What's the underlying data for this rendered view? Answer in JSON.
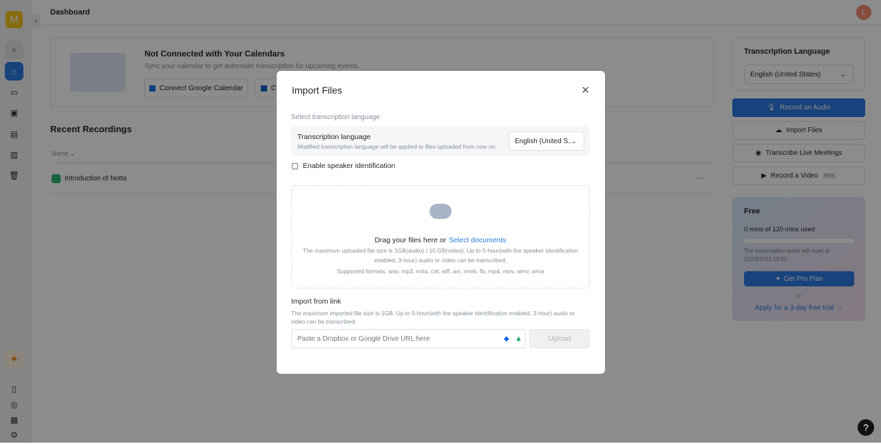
{
  "sidebar": {
    "logo_letter": "M",
    "icons": [
      "search-icon",
      "home-icon",
      "folder-icon",
      "calendar-icon",
      "calendar-edit-icon",
      "notes-icon",
      "trash-icon"
    ],
    "bottom_icons": [
      "book-icon",
      "location-icon",
      "gift-icon",
      "settings-icon"
    ]
  },
  "header": {
    "title": "Dashboard",
    "avatar_letter": "L"
  },
  "calendar": {
    "title": "Not Connected with Your Calendars",
    "subtitle": "Sync your calendar to get automatic transcription for upcoming events.",
    "google_button": "Connect Google Calendar",
    "outlook_button": "C"
  },
  "recordings": {
    "title": "Recent Recordings",
    "column_name": "Name",
    "items": [
      {
        "name": "Introduction of Notta",
        "more": "···"
      }
    ]
  },
  "right_panel": {
    "language_title": "Transcription Language",
    "language_value": "English (United States)",
    "record_audio": "Record an Audio",
    "import_files": "Import Files",
    "transcribe_live": "Transcribe Live Meetings",
    "record_video": "Record a Video",
    "beta": "Beta",
    "plan": {
      "name": "Free",
      "usage": "0 mins of 120 mins used",
      "usage_fraction": 0,
      "reset_note": "The transcription quote will reset at 12/19/2023 10:52",
      "pro_button": "Get Pro Plan",
      "or": "or",
      "trial_link": "Apply for a 3-day free trial →"
    }
  },
  "modal": {
    "title": "Import Files",
    "section_label": "Select transcription language",
    "lang_title": "Transcription language",
    "lang_desc": "Modified transcription language will be applied to files uploaded from now on.",
    "lang_value": "English (United S...",
    "speaker_label": "Enable speaker identification",
    "speaker_checked": false,
    "drop_text": "Drag your files here or",
    "select_link": "Select documents",
    "drop_limits": "The maximum uploaded file size is 1GB(audio) / 10 GB(video). Up to 5-hour(with the speaker identification enabled, 3-hour) audio or video can be transcribed.",
    "drop_formats": "Supported formats: wav, mp3, m4a, caf, aiff, avi, rmvb, flv, mp4, mov, wmv, wma",
    "link_title": "Import from link",
    "link_desc": "The maximum imported file size is 1GB. Up to 5-hour(with the speaker identification enabled, 3-hour) audio or video can be transcribed.",
    "link_placeholder": "Paste a Dropbox or Google Drive URL here",
    "upload_button": "Upload"
  },
  "help": "?"
}
